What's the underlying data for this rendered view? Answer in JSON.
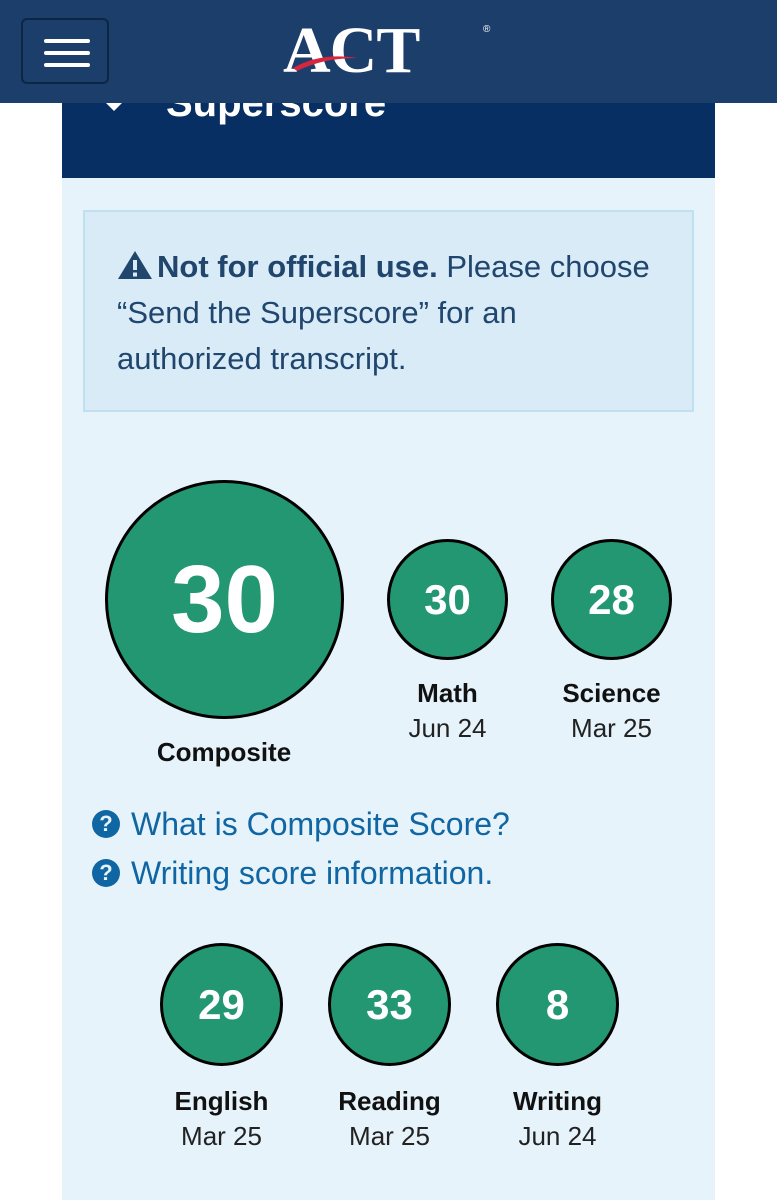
{
  "header": {
    "logo_text": "ACT",
    "logo_reg": "®",
    "colors": {
      "bar": "#1c3e6b",
      "swoosh": "#d7263d"
    }
  },
  "panel": {
    "title": "Superscore",
    "caret_icon": "caret-down-icon"
  },
  "alert": {
    "icon": "warning-icon",
    "bold": "Not for official use.",
    "text": " Please choose “Send the Superscore” for an authorized transcript."
  },
  "scores": {
    "composite": {
      "value": "30",
      "label": "Composite"
    },
    "math": {
      "value": "30",
      "label": "Math",
      "date": "Jun 24"
    },
    "science": {
      "value": "28",
      "label": "Science",
      "date": "Mar 25"
    },
    "english": {
      "value": "29",
      "label": "English",
      "date": "Mar 25"
    },
    "reading": {
      "value": "33",
      "label": "Reading",
      "date": "Mar 25"
    },
    "writing": {
      "value": "8",
      "label": "Writing",
      "date": "Jun 24"
    },
    "circle_color": "#239771"
  },
  "links": {
    "composite_info": "What is Composite Score?",
    "writing_info": "Writing score information.",
    "icon": "question-circle-icon"
  }
}
